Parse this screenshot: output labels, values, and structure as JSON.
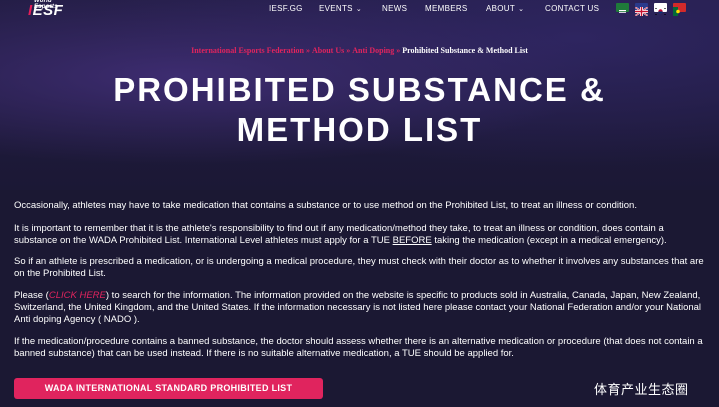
{
  "logo": {
    "small_text": "World Esports",
    "brand_letter": "I",
    "brand_rest": "ESF"
  },
  "nav": {
    "items": [
      {
        "label": "IESF.GG",
        "dropdown": false
      },
      {
        "label": "EVENTS",
        "dropdown": true
      },
      {
        "label": "NEWS",
        "dropdown": false
      },
      {
        "label": "MEMBERS",
        "dropdown": false
      },
      {
        "label": "ABOUT",
        "dropdown": true
      },
      {
        "label": "CONTACT US",
        "dropdown": false
      }
    ],
    "chevron": "⌄",
    "flags": [
      {
        "name": "saudi-flag-icon",
        "color": "#1f7a3a"
      },
      {
        "name": "uk-flag-icon",
        "color": "#2a3a8c"
      },
      {
        "name": "korea-flag-icon",
        "color": "#ffffff"
      },
      {
        "name": "portugal-flag-icon",
        "color": "#d22a2a"
      }
    ]
  },
  "breadcrumb": {
    "items": [
      "International Esports Federation",
      "About Us",
      "Anti Doping"
    ],
    "separator": "»",
    "current": "Prohibited Substance & Method List"
  },
  "page": {
    "title_line1": "PROHIBITED SUBSTANCE &",
    "title_line2": "METHOD LIST"
  },
  "content": {
    "p1": "Occasionally, athletes may have to take medication that contains a substance or to use method on the Prohibited List, to treat an illness or condition.",
    "p2_a": "It is important to remember that it is the athlete's responsibility to find out if any medication/method they take, to treat an illness or condition, does contain a substance on the WADA Prohibited List. International Level athletes must apply for a TUE ",
    "p2_u": "BEFORE",
    "p2_b": " taking the medication (except in a medical emergency).",
    "p3": "So if an athlete is prescribed a medication, or is undergoing a medical procedure, they must check with their doctor as to whether it involves any substances that are on the Prohibited List.",
    "p4_a": "Please (",
    "p4_link": "CLICK HERE",
    "p4_b": ") to search for the information. The information provided on the website is specific to products sold in Australia, Canada, Japan, New Zealand, Switzerland, the United Kingdom, and the United States. If the information necessary is not listed here please contact your National Federation and/or your National Anti doping Agency ( NADO ).",
    "p5": "If the medication/procedure contains a banned substance, the doctor should assess whether there is an alternative medication or procedure (that does not contain a banned substance) that can be used instead. If there is no suitable alternative medication, a TUE should be applied for.",
    "button_label": "WADA INTERNATIONAL STANDARD PROHIBITED LIST"
  },
  "watermark": "体育产业生态圈",
  "colors": {
    "accent": "#e0245e",
    "background": "#1b1833"
  }
}
